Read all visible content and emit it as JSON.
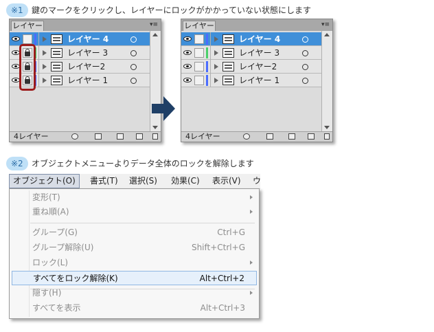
{
  "step1": {
    "badge": "※1",
    "text": "鍵のマークをクリックし、レイヤーにロックがかかっていない状態にします"
  },
  "step2": {
    "badge": "※2",
    "text": "オブジェクトメニューよりデータ全体のロックを解除します"
  },
  "panel_tab": "レイヤー",
  "panel_menu_glyph": "▾≡",
  "panel_count": "4レイヤー",
  "layers_before": [
    {
      "name": "レイヤー 4",
      "selected": true,
      "locked": false,
      "color": "#4a6cff"
    },
    {
      "name": "レイヤー 3",
      "selected": false,
      "locked": true,
      "color": "#4ad06a"
    },
    {
      "name": "レイヤー2",
      "selected": false,
      "locked": true,
      "color": "#4a6cff"
    },
    {
      "name": "レイヤー 1",
      "selected": false,
      "locked": true,
      "color": "#4a6cff"
    }
  ],
  "layers_after": [
    {
      "name": "レイヤー 4",
      "selected": true,
      "locked": false,
      "color": "#4a6cff"
    },
    {
      "name": "レイヤー 3",
      "selected": false,
      "locked": false,
      "color": "#4ad06a"
    },
    {
      "name": "レイヤー2",
      "selected": false,
      "locked": false,
      "color": "#4a6cff"
    },
    {
      "name": "レイヤー 1",
      "selected": false,
      "locked": false,
      "color": "#4a6cff"
    }
  ],
  "menubar": [
    "オブジェクト(O)",
    "書式(T)",
    "選択(S)",
    "効果(C)",
    "表示(V)",
    "ウ"
  ],
  "menu_items": [
    {
      "label": "変形(T)",
      "shortcut": "",
      "submenu": true
    },
    {
      "label": "重ね順(A)",
      "shortcut": "",
      "submenu": true
    },
    {
      "label": "グループ(G)",
      "shortcut": "Ctrl+G",
      "submenu": false
    },
    {
      "label": "グループ解除(U)",
      "shortcut": "Shift+Ctrl+G",
      "submenu": false
    },
    {
      "label": "ロック(L)",
      "shortcut": "",
      "submenu": true
    },
    {
      "label": "すべてをロック解除(K)",
      "shortcut": "Alt+Ctrl+2",
      "submenu": false,
      "active": true
    },
    {
      "label": "隠す(H)",
      "shortcut": "",
      "submenu": true
    },
    {
      "label": "すべてを表示",
      "shortcut": "Alt+Ctrl+3",
      "submenu": false
    }
  ],
  "colors": {
    "selection": "#3f8fd9",
    "highlight": "#9c1c1c",
    "arrow": "#1f3f66",
    "badge_bg": "#bfe0f7"
  }
}
